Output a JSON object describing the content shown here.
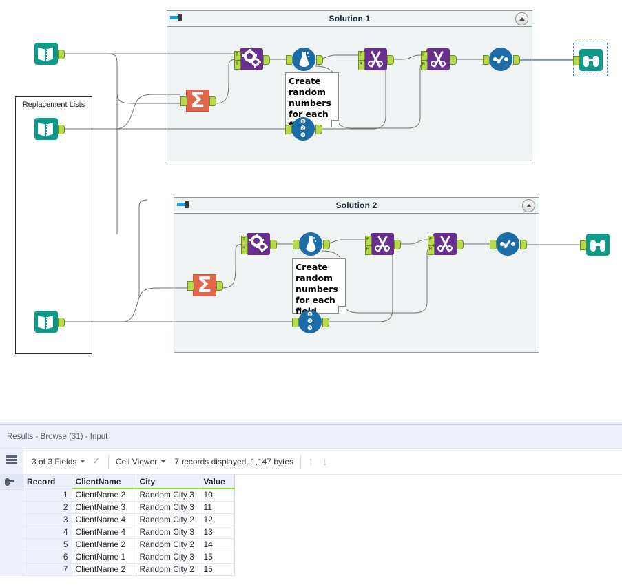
{
  "canvas": {
    "containers": [
      {
        "name": "Solution 1",
        "collapse_icon": "chevron-up-icon",
        "tool_icon": "container-icon"
      },
      {
        "name": "Solution 2",
        "collapse_icon": "chevron-up-icon",
        "tool_icon": "container-icon"
      }
    ],
    "group_box_label": "Replacement Lists",
    "comments": [
      "Create random numbers for each field",
      "Create random numbers for each field"
    ],
    "tools": {
      "text_input": "text-input-tool",
      "summarize": "summarize-tool",
      "find_replace": "find-replace-tool",
      "generate_rows": "generate-rows-tool",
      "record_id": "record-id-tool",
      "select": "select-tool",
      "browse": "browse-tool"
    },
    "anchor_labels": {
      "t": "T",
      "s": "S",
      "f": "F",
      "r": "R"
    },
    "record_id_digits": [
      "1",
      "2",
      "3"
    ]
  },
  "results": {
    "title": "Results - Browse (31) - Input",
    "toolbar": {
      "fields_selector": "3 of 3 Fields",
      "check_icon": "check-icon",
      "view_mode": "Cell Viewer",
      "record_status": "7 records displayed, 1,147 bytes",
      "up_icon": "arrow-up-icon",
      "down_icon": "arrow-down-icon",
      "list_icon": "list-icon",
      "browse_icon": "binoculars-icon"
    },
    "columns": [
      "Record",
      "ClientName",
      "City",
      "Value"
    ],
    "rows": [
      [
        "1",
        "ClientName 2",
        "Random City 3",
        "10"
      ],
      [
        "2",
        "ClientName 3",
        "Random City 3",
        "11"
      ],
      [
        "3",
        "ClientName 4",
        "Random City 2",
        "12"
      ],
      [
        "4",
        "ClientName 4",
        "Random City 3",
        "13"
      ],
      [
        "5",
        "ClientName 2",
        "Random City 2",
        "14"
      ],
      [
        "6",
        "ClientName 1",
        "Random City 3",
        "15"
      ],
      [
        "7",
        "ClientName 2",
        "Random City 2",
        "15"
      ]
    ]
  },
  "colors": {
    "teal": "#0d9a88",
    "purple": "#682f8e",
    "blue": "#1c6ca8",
    "orange": "#e2674a",
    "anchor_green": "#b7d94c",
    "container_fill": "#eff3f4",
    "container_border": "#8a9a9a",
    "header_green_underline": "#8fd34a",
    "selection_blue": "#2a7fd4"
  }
}
